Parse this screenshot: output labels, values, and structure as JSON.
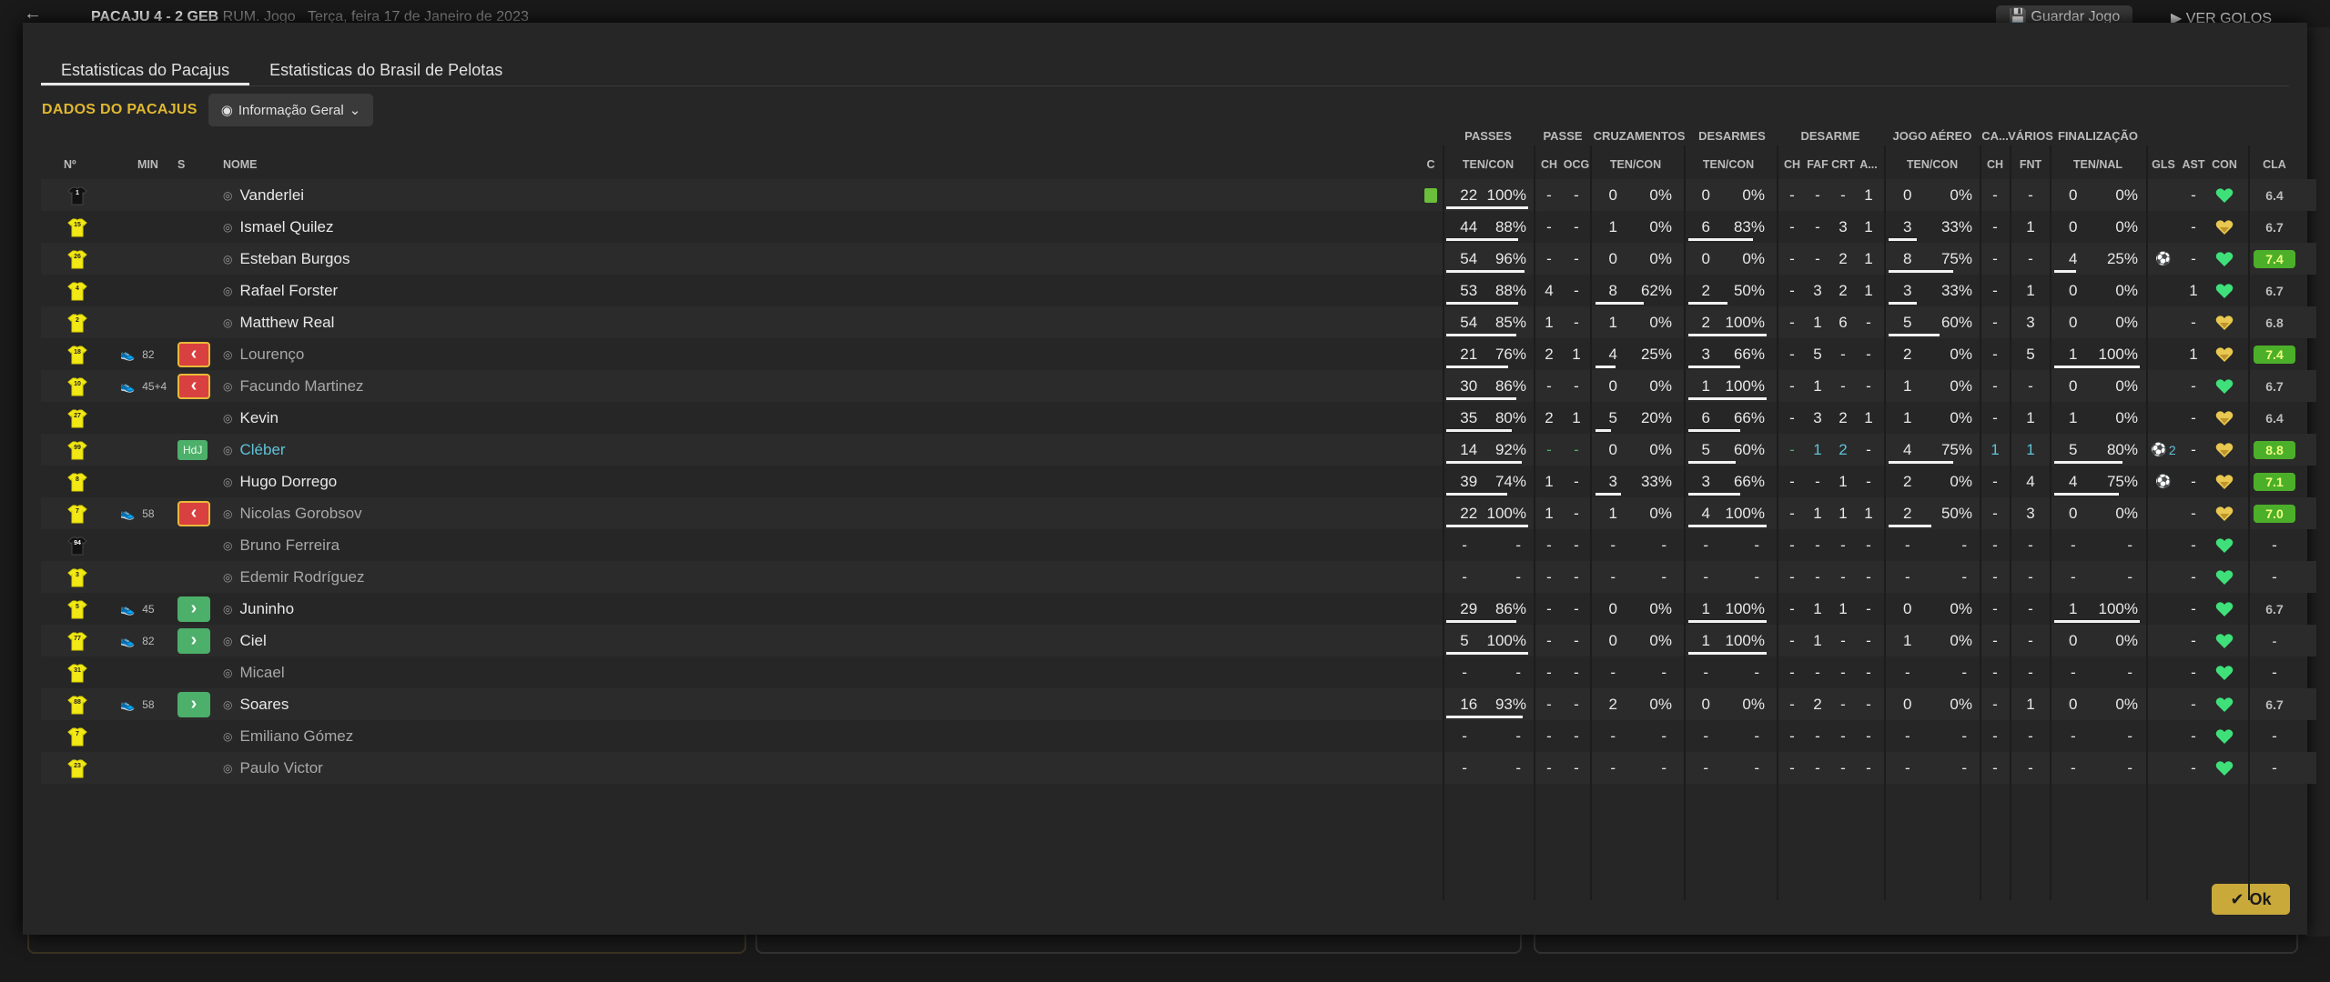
{
  "background": {
    "title_team": "PACAJU",
    "score": "4 - 2",
    "opponent": "GEB",
    "extra": "RUM. Jogo",
    "date": "Terça, feira 17 de Janeiro de 2023",
    "save_label": "Guardar Jogo",
    "view_goals_label": "VER GOLOS"
  },
  "tabs": [
    {
      "label": "Estatisticas do Pacajus",
      "active": true
    },
    {
      "label": "Estatisticas do Brasil de Pelotas",
      "active": false
    }
  ],
  "section": {
    "title": "DADOS DO PACAJUS",
    "dropdown": "Informação Geral"
  },
  "group_headers": {
    "passes": "PASSES",
    "passe": "PASSE",
    "cruz": "CRUZAMENTOS",
    "des": "DESARMES",
    "desarme": "DESARME",
    "aereo": "JOGO AÉREO",
    "ca": "CA...",
    "varios": "VÁRIOS",
    "final": "FINALIZAÇÃO"
  },
  "headers": {
    "num": "Nº",
    "min": "MIN",
    "s": "S",
    "nome": "NOME",
    "c": "C",
    "ten_con1": "TEN/CON",
    "ch1": "CH",
    "ocg": "OCG",
    "ten_con2": "TEN/CON",
    "ten_con3": "TEN/CON",
    "ch2": "CH",
    "faf": "FAF",
    "crt": "CRT",
    "a": "A...",
    "ten_con4": "TEN/CON",
    "ch3": "CH",
    "fnt": "FNT",
    "ten_nal": "TEN/NAL",
    "gls": "GLS",
    "ast": "AST",
    "con": "CON",
    "cla": "CLA"
  },
  "colors": {
    "accent": "#e0b830",
    "good_rating": "#4caf2a",
    "sub_off": "#d94040",
    "sub_on": "#4caf6a",
    "highlight": "#5fc3d9"
  },
  "players": [
    {
      "shirt": "gk",
      "num": "1",
      "min": "",
      "sub": "",
      "name": "Vanderlei",
      "card": true,
      "p": [
        "22",
        "100%",
        1.0
      ],
      "pch": "-",
      "ocg": "-",
      "cr": [
        "0",
        "0%",
        0
      ],
      "de": [
        "0",
        "0%",
        0
      ],
      "dch": "-",
      "faf": "-",
      "crt": "-",
      "a": "1",
      "ae": [
        "0",
        "0%",
        0
      ],
      "ca": "-",
      "fnt": "-",
      "fi": [
        "0",
        "0%",
        0
      ],
      "gls": "",
      "ast": "-",
      "con": "happy",
      "cla": "6.4",
      "good": false
    },
    {
      "shirt": "y",
      "num": "15",
      "min": "",
      "sub": "",
      "name": "Ismael Quilez",
      "p": [
        "44",
        "88%",
        0.88
      ],
      "pch": "-",
      "ocg": "-",
      "cr": [
        "1",
        "0%",
        0
      ],
      "de": [
        "6",
        "83%",
        0.83
      ],
      "dch": "-",
      "faf": "-",
      "crt": "3",
      "a": "1",
      "ae": [
        "3",
        "33%",
        0.33
      ],
      "ca": "-",
      "fnt": "1",
      "fi": [
        "0",
        "0%",
        0
      ],
      "gls": "",
      "ast": "-",
      "con": "ok",
      "cla": "6.7",
      "good": false
    },
    {
      "shirt": "y",
      "num": "26",
      "min": "",
      "sub": "",
      "name": "Esteban Burgos",
      "p": [
        "54",
        "96%",
        0.96
      ],
      "pch": "-",
      "ocg": "-",
      "cr": [
        "0",
        "0%",
        0
      ],
      "de": [
        "0",
        "0%",
        0
      ],
      "dch": "-",
      "faf": "-",
      "crt": "2",
      "a": "1",
      "ae": [
        "8",
        "75%",
        0.75
      ],
      "ca": "-",
      "fnt": "-",
      "fi": [
        "4",
        "25%",
        0.25
      ],
      "gls": "ball",
      "ast": "-",
      "con": "happy",
      "cla": "7.4",
      "good": true
    },
    {
      "shirt": "y",
      "num": "4",
      "min": "",
      "sub": "",
      "name": "Rafael Forster",
      "p": [
        "53",
        "88%",
        0.88
      ],
      "pch": "4",
      "ocg": "-",
      "cr": [
        "8",
        "62%",
        0.62
      ],
      "de": [
        "2",
        "50%",
        0.5
      ],
      "dch": "-",
      "faf": "3",
      "crt": "2",
      "a": "1",
      "ae": [
        "3",
        "33%",
        0.33
      ],
      "ca": "-",
      "fnt": "1",
      "fi": [
        "0",
        "0%",
        0
      ],
      "gls": "",
      "ast": "1",
      "con": "happy",
      "cla": "6.7",
      "good": false
    },
    {
      "shirt": "y",
      "num": "2",
      "min": "",
      "sub": "",
      "name": "Matthew Real",
      "p": [
        "54",
        "85%",
        0.85
      ],
      "pch": "1",
      "ocg": "-",
      "cr": [
        "1",
        "0%",
        0
      ],
      "de": [
        "2",
        "100%",
        1.0
      ],
      "dch": "-",
      "faf": "1",
      "crt": "6",
      "a": "-",
      "ae": [
        "5",
        "60%",
        0.6
      ],
      "ca": "-",
      "fnt": "3",
      "fi": [
        "0",
        "0%",
        0
      ],
      "gls": "",
      "ast": "-",
      "con": "ok",
      "cla": "6.8",
      "good": false
    },
    {
      "shirt": "y",
      "num": "18",
      "min": "82",
      "sub": "off",
      "name": "Lourenço",
      "p": [
        "21",
        "76%",
        0.76
      ],
      "pch": "2",
      "ocg": "1",
      "cr": [
        "4",
        "25%",
        0.25
      ],
      "de": [
        "3",
        "66%",
        0.66
      ],
      "dch": "-",
      "faf": "5",
      "crt": "-",
      "a": "-",
      "ae": [
        "2",
        "0%",
        0
      ],
      "ca": "-",
      "fnt": "5",
      "fi": [
        "1",
        "100%",
        1.0
      ],
      "gls": "",
      "ast": "1",
      "con": "ok",
      "cla": "7.4",
      "good": true
    },
    {
      "shirt": "y",
      "num": "10",
      "min": "45+4",
      "sub": "off",
      "name": "Facundo Martinez",
      "p": [
        "30",
        "86%",
        0.86
      ],
      "pch": "-",
      "ocg": "-",
      "cr": [
        "0",
        "0%",
        0
      ],
      "de": [
        "1",
        "100%",
        1.0
      ],
      "dch": "-",
      "faf": "1",
      "crt": "-",
      "a": "-",
      "ae": [
        "1",
        "0%",
        0
      ],
      "ca": "-",
      "fnt": "-",
      "fi": [
        "0",
        "0%",
        0
      ],
      "gls": "",
      "ast": "-",
      "con": "happy",
      "cla": "6.7",
      "good": false
    },
    {
      "shirt": "y",
      "num": "27",
      "min": "",
      "sub": "",
      "name": "Kevin",
      "p": [
        "35",
        "80%",
        0.8
      ],
      "pch": "2",
      "ocg": "1",
      "cr": [
        "5",
        "20%",
        0.2
      ],
      "de": [
        "6",
        "66%",
        0.66
      ],
      "dch": "-",
      "faf": "3",
      "crt": "2",
      "a": "1",
      "ae": [
        "1",
        "0%",
        0
      ],
      "ca": "-",
      "fnt": "1",
      "fi": [
        "1",
        "0%",
        0
      ],
      "gls": "",
      "ast": "-",
      "con": "ok",
      "cla": "6.4",
      "good": false
    },
    {
      "shirt": "y",
      "num": "99",
      "min": "",
      "sub": "hdj",
      "name": "Cléber",
      "p": [
        "14",
        "92%",
        0.92
      ],
      "pch": "-",
      "ocg": "-",
      "cr": [
        "0",
        "0%",
        0
      ],
      "de": [
        "5",
        "60%",
        0.6
      ],
      "dch": "-",
      "faf": "1",
      "crt": "2",
      "a": "-",
      "ae": [
        "4",
        "75%",
        0.75
      ],
      "ca": "1",
      "fnt": "1",
      "fi": [
        "5",
        "80%",
        0.8
      ],
      "gls": "ball2",
      "ast": "-",
      "con": "ok",
      "cla": "8.8",
      "good": true
    },
    {
      "shirt": "y",
      "num": "8",
      "min": "",
      "sub": "",
      "name": "Hugo Dorrego",
      "p": [
        "39",
        "74%",
        0.74
      ],
      "pch": "1",
      "ocg": "-",
      "cr": [
        "3",
        "33%",
        0.33
      ],
      "de": [
        "3",
        "66%",
        0.66
      ],
      "dch": "-",
      "faf": "-",
      "crt": "1",
      "a": "-",
      "ae": [
        "2",
        "0%",
        0
      ],
      "ca": "-",
      "fnt": "4",
      "fi": [
        "4",
        "75%",
        0.75
      ],
      "gls": "ball",
      "ast": "-",
      "con": "ok",
      "cla": "7.1",
      "good": true
    },
    {
      "shirt": "y",
      "num": "7",
      "min": "58",
      "sub": "off",
      "name": "Nicolas Gorobsov",
      "p": [
        "22",
        "100%",
        1.0
      ],
      "pch": "1",
      "ocg": "-",
      "cr": [
        "1",
        "0%",
        0
      ],
      "de": [
        "4",
        "100%",
        1.0
      ],
      "dch": "-",
      "faf": "1",
      "crt": "1",
      "a": "1",
      "ae": [
        "2",
        "50%",
        0.5
      ],
      "ca": "-",
      "fnt": "3",
      "fi": [
        "0",
        "0%",
        0
      ],
      "gls": "",
      "ast": "-",
      "con": "ok",
      "cla": "7.0",
      "good": true
    },
    {
      "shirt": "gk",
      "num": "94",
      "min": "",
      "sub": "",
      "name": "Bruno Ferreira",
      "empty": true,
      "con": "happy"
    },
    {
      "shirt": "y",
      "num": "3",
      "min": "",
      "sub": "",
      "name": "Edemir Rodríguez",
      "empty": true,
      "con": "happy"
    },
    {
      "shirt": "y",
      "num": "5",
      "min": "45",
      "sub": "on",
      "name": "Juninho",
      "p": [
        "29",
        "86%",
        0.86
      ],
      "pch": "-",
      "ocg": "-",
      "cr": [
        "0",
        "0%",
        0
      ],
      "de": [
        "1",
        "100%",
        1.0
      ],
      "dch": "-",
      "faf": "1",
      "crt": "1",
      "a": "-",
      "ae": [
        "0",
        "0%",
        0
      ],
      "ca": "-",
      "fnt": "-",
      "fi": [
        "1",
        "100%",
        1.0
      ],
      "gls": "",
      "ast": "-",
      "con": "happy",
      "cla": "6.7",
      "good": false
    },
    {
      "shirt": "y",
      "num": "77",
      "min": "82",
      "sub": "on",
      "name": "Ciel",
      "p": [
        "5",
        "100%",
        1.0
      ],
      "pch": "-",
      "ocg": "-",
      "cr": [
        "0",
        "0%",
        0
      ],
      "de": [
        "1",
        "100%",
        1.0
      ],
      "dch": "-",
      "faf": "1",
      "crt": "-",
      "a": "-",
      "ae": [
        "1",
        "0%",
        0
      ],
      "ca": "-",
      "fnt": "-",
      "fi": [
        "0",
        "0%",
        0
      ],
      "gls": "",
      "ast": "-",
      "con": "happy",
      "cla": "-",
      "good": false
    },
    {
      "shirt": "y",
      "num": "31",
      "min": "",
      "sub": "",
      "name": "Micael",
      "empty": true,
      "con": "happy"
    },
    {
      "shirt": "y",
      "num": "88",
      "min": "58",
      "sub": "on",
      "name": "Soares",
      "p": [
        "16",
        "93%",
        0.93
      ],
      "pch": "-",
      "ocg": "-",
      "cr": [
        "2",
        "0%",
        0
      ],
      "de": [
        "0",
        "0%",
        0
      ],
      "dch": "-",
      "faf": "2",
      "crt": "-",
      "a": "-",
      "ae": [
        "0",
        "0%",
        0
      ],
      "ca": "-",
      "fnt": "1",
      "fi": [
        "0",
        "0%",
        0
      ],
      "gls": "",
      "ast": "-",
      "con": "happy",
      "cla": "6.7",
      "good": false
    },
    {
      "shirt": "y",
      "num": "7",
      "min": "",
      "sub": "",
      "name": "Emiliano Gómez",
      "empty": true,
      "con": "happy"
    },
    {
      "shirt": "y",
      "num": "23",
      "min": "",
      "sub": "",
      "name": "Paulo Victor",
      "empty": true,
      "con": "happy"
    }
  ],
  "ok_label": "Ok"
}
